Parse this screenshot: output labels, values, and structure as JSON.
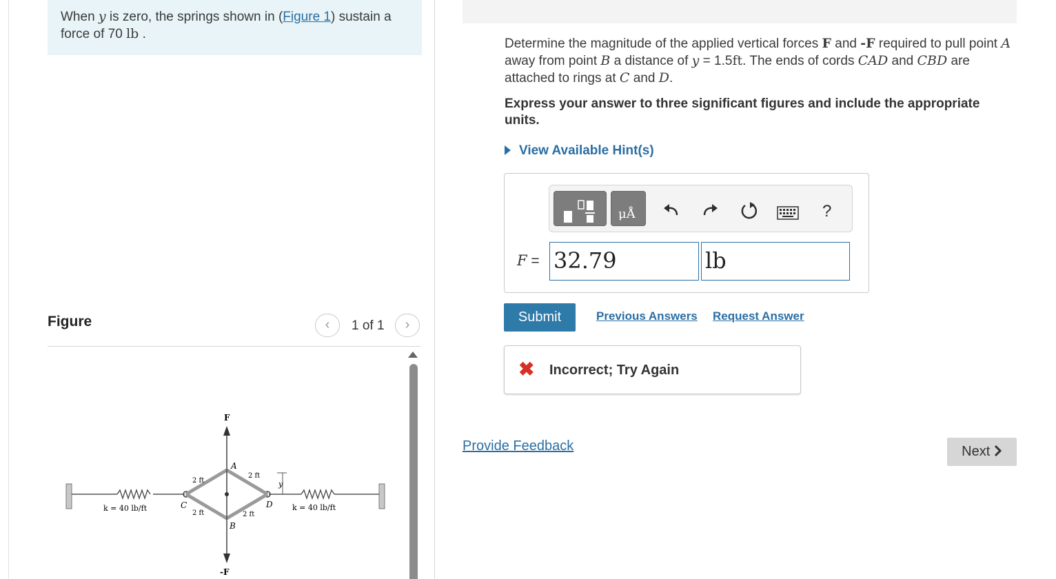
{
  "prompt": {
    "text_before": "When ",
    "var_y": "y",
    "text_mid": " is zero, the springs shown in (",
    "figure_link": "Figure 1",
    "text_after": ") sustain a force of 70 ",
    "unit": "lb",
    "period": " ."
  },
  "figure_panel": {
    "title": "Figure",
    "prev": "‹",
    "next": "›",
    "counter": "1 of 1",
    "diagram": {
      "F_top": "F",
      "F_bottom": "-F",
      "label_A": "A",
      "label_B": "B",
      "label_C": "C",
      "label_D": "D",
      "label_y": "y",
      "len_ul": "2 ft",
      "len_ur": "2 ft",
      "len_ll": "2 ft",
      "len_lr": "2 ft",
      "k_left": "k = 40 lb/ft",
      "k_right": "k = 40 lb/ft"
    }
  },
  "question": {
    "p1": "Determine the magnitude of the applied vertical forces ",
    "F": "F",
    "and1": " and ",
    "negF": "-F",
    "p2": " required to pull point ",
    "A": "A",
    "p3": " away from point ",
    "B": "B",
    "p4": " a distance of ",
    "y": "y",
    "eq": " = 1.5",
    "ft": "ft",
    "p5": ". The ends of cords ",
    "CAD": "CAD",
    "and2": " and ",
    "CBD": "CBD",
    "p6": " are attached to rings at ",
    "C": "C",
    "and3": " and ",
    "D": "D",
    "p7": "."
  },
  "instruction": "Express your answer to three significant figures and include the appropriate units.",
  "hints_label": "View Available Hint(s)",
  "toolbar": {
    "units_symbol": "μÅ",
    "undo_icon": "undo-icon",
    "redo_icon": "redo-icon",
    "reset_icon": "reset-icon",
    "keyboard_icon": "keyboard-icon",
    "help": "?"
  },
  "answer": {
    "label_var": "F",
    "label_eq": " =",
    "value": "32.79",
    "unit": "lb"
  },
  "submit_label": "Submit",
  "previous_answers": "Previous Answers",
  "request_answer": "Request Answer",
  "feedback": {
    "icon": "✖",
    "text": "Incorrect; Try Again"
  },
  "provide_feedback": "Provide Feedback",
  "next_label": "Next",
  "colors": {
    "link": "#2a6ea3",
    "submit_bg": "#2e7aa8",
    "error": "#d93025",
    "prompt_bg": "#e8f4f7"
  }
}
